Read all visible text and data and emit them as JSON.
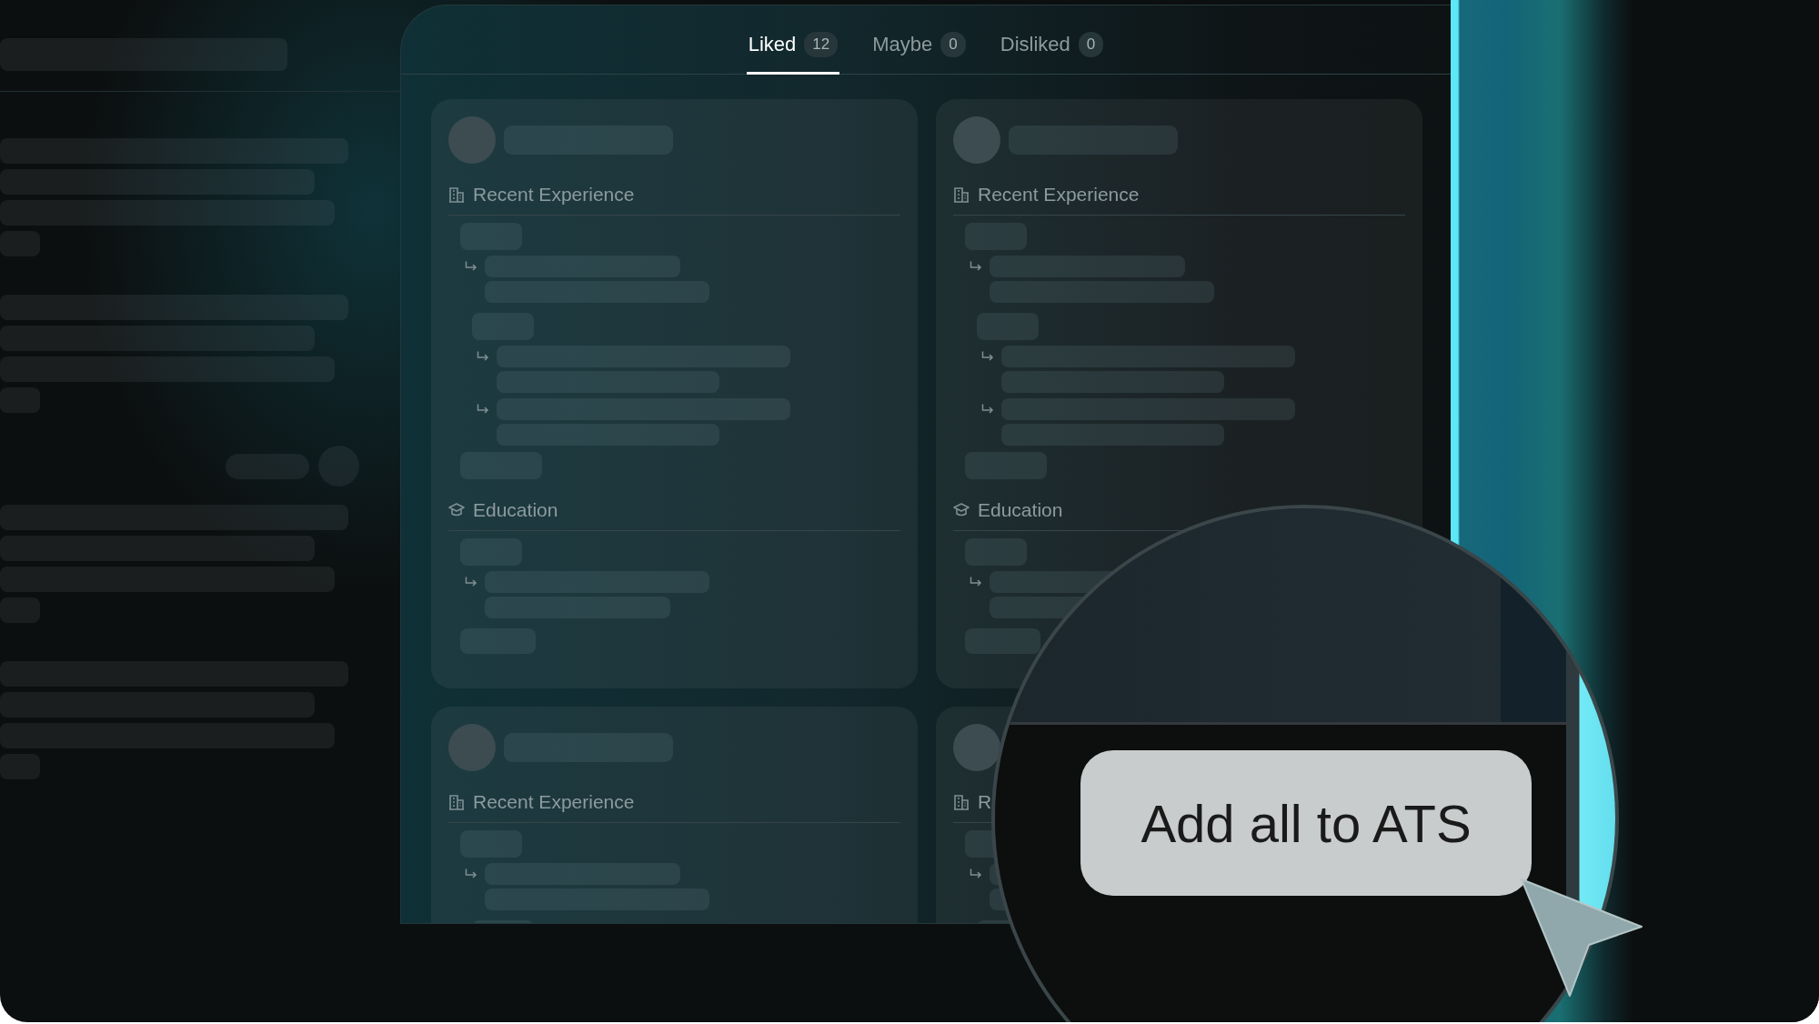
{
  "tabs": [
    {
      "label": "Liked",
      "count": "12",
      "selected": true
    },
    {
      "label": "Maybe",
      "count": "0",
      "selected": false
    },
    {
      "label": "Disliked",
      "count": "0",
      "selected": false
    }
  ],
  "candidates": [
    {
      "sections": [
        {
          "kind": "experience",
          "title": "Recent Experience"
        },
        {
          "kind": "education",
          "title": "Education"
        }
      ]
    },
    {
      "sections": [
        {
          "kind": "experience",
          "title": "Recent Experience"
        },
        {
          "kind": "education",
          "title": "Education"
        }
      ]
    },
    {
      "sections": [
        {
          "kind": "experience",
          "title": "Recent Experience"
        }
      ]
    },
    {
      "sections": [
        {
          "kind": "experience",
          "title": "R"
        }
      ]
    }
  ],
  "action_button": {
    "label": "Add all to ATS"
  }
}
